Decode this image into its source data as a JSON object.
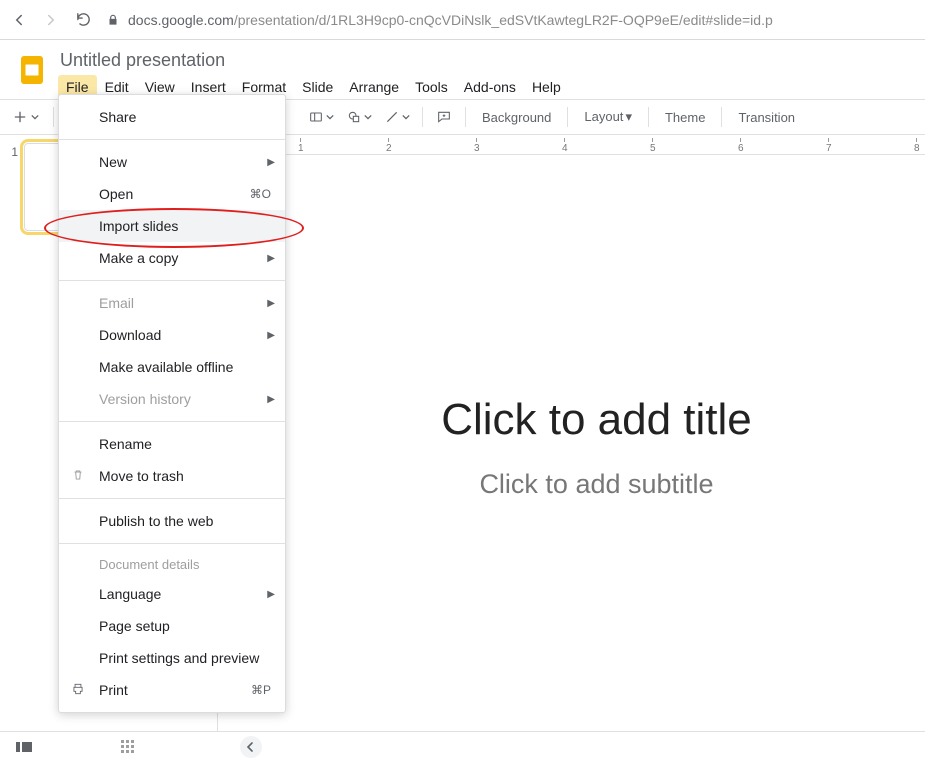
{
  "browser": {
    "url_host": "docs.google.com",
    "url_path": "/presentation/d/1RL3H9cp0-cnQcVDiNslk_edSVtKawtegLR2F-OQP9eE/edit#slide=id.p"
  },
  "doc": {
    "title": "Untitled presentation"
  },
  "menus": {
    "items": [
      "File",
      "Edit",
      "View",
      "Insert",
      "Format",
      "Slide",
      "Arrange",
      "Tools",
      "Add-ons",
      "Help"
    ],
    "active_index": 0
  },
  "toolbar": {
    "background": "Background",
    "layout": "Layout",
    "theme": "Theme",
    "transition": "Transition"
  },
  "file_menu": {
    "share": "Share",
    "new": "New",
    "open": "Open",
    "open_shortcut": "⌘O",
    "import": "Import slides",
    "copy": "Make a copy",
    "email": "Email",
    "download": "Download",
    "offline": "Make available offline",
    "version": "Version history",
    "rename": "Rename",
    "trash": "Move to trash",
    "publish": "Publish to the web",
    "docdetails": "Document details",
    "language": "Language",
    "pagesetup": "Page setup",
    "printsettings": "Print settings and preview",
    "print": "Print",
    "print_shortcut": "⌘P"
  },
  "slide": {
    "title_placeholder": "Click to add title",
    "subtitle_placeholder": "Click to add subtitle"
  },
  "thumbs": {
    "first_index": "1"
  },
  "ruler": {
    "marks": [
      "1",
      "2",
      "3",
      "4",
      "5",
      "6",
      "7",
      "8"
    ]
  }
}
